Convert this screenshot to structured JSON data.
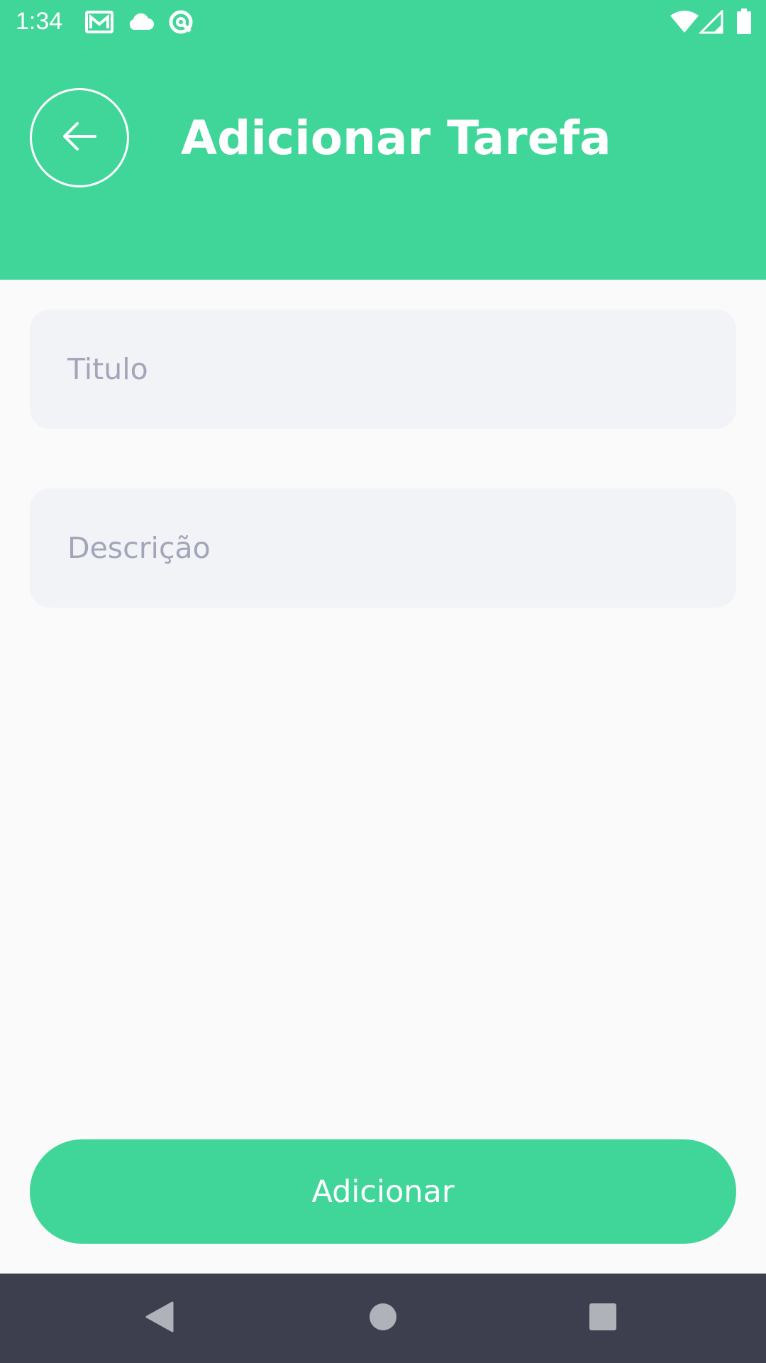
{
  "status_bar": {
    "time": "1:34",
    "icons": [
      "gmail-icon",
      "cloud-icon",
      "assistant-icon",
      "wifi-icon",
      "signal-icon",
      "battery-icon"
    ]
  },
  "header": {
    "title": "Adicionar Tarefa",
    "back_icon": "arrow-left-icon"
  },
  "form": {
    "title_placeholder": "Titulo",
    "title_value": "",
    "description_placeholder": "Descrição",
    "description_value": ""
  },
  "actions": {
    "submit_label": "Adicionar"
  },
  "nav_bar": {
    "icons": [
      "back-triangle-icon",
      "home-circle-icon",
      "recents-square-icon"
    ]
  },
  "colors": {
    "accent": "#40d699",
    "background": "#fafafa",
    "field_background": "#f2f3f7",
    "placeholder": "#a3a6b8",
    "nav_bar": "#3d3f4e"
  }
}
